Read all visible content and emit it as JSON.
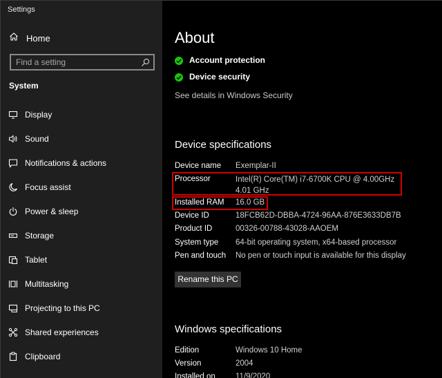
{
  "app": {
    "title": "Settings"
  },
  "sidebar": {
    "home_label": "Home",
    "search": {
      "placeholder": "Find a setting",
      "value": ""
    },
    "section_label": "System",
    "items": [
      {
        "label": "Display",
        "icon": "monitor-icon"
      },
      {
        "label": "Sound",
        "icon": "speaker-icon"
      },
      {
        "label": "Notifications & actions",
        "icon": "notification-icon"
      },
      {
        "label": "Focus assist",
        "icon": "moon-icon"
      },
      {
        "label": "Power & sleep",
        "icon": "power-icon"
      },
      {
        "label": "Storage",
        "icon": "storage-icon"
      },
      {
        "label": "Tablet",
        "icon": "tablet-icon"
      },
      {
        "label": "Multitasking",
        "icon": "multitasking-icon"
      },
      {
        "label": "Projecting to this PC",
        "icon": "projector-icon"
      },
      {
        "label": "Shared experiences",
        "icon": "shared-experiences-icon"
      },
      {
        "label": "Clipboard",
        "icon": "clipboard-icon"
      }
    ]
  },
  "main": {
    "title": "About",
    "security_items": [
      {
        "label": "Account protection",
        "icon": "check-circle-icon"
      },
      {
        "label": "Device security",
        "icon": "check-circle-icon"
      }
    ],
    "security_link": "See details in Windows Security",
    "device_specs": {
      "heading": "Device specifications",
      "rows": [
        {
          "label": "Device name",
          "value": "Exemplar-II"
        },
        {
          "label": "Processor",
          "value": "Intel(R) Core(TM) i7-6700K CPU @ 4.00GHz   4.01 GHz"
        },
        {
          "label": "Installed RAM",
          "value": "16.0 GB"
        },
        {
          "label": "Device ID",
          "value": "18FCB62D-DBBA-4724-96AA-876E3633DB7B"
        },
        {
          "label": "Product ID",
          "value": "00326-00788-43028-AAOEM"
        },
        {
          "label": "System type",
          "value": "64-bit operating system, x64-based processor"
        },
        {
          "label": "Pen and touch",
          "value": "No pen or touch input is available for this display"
        }
      ],
      "rename_button": "Rename this PC"
    },
    "windows_specs": {
      "heading": "Windows specifications",
      "rows": [
        {
          "label": "Edition",
          "value": "Windows 10 Home"
        },
        {
          "label": "Version",
          "value": "2004"
        },
        {
          "label": "Installed on",
          "value": "11/9/2020"
        }
      ]
    }
  },
  "colors": {
    "sidebar_bg": "#1f1f1f",
    "content_bg": "#000000",
    "check_green": "#16c60c",
    "highlight_red": "#d40000"
  }
}
